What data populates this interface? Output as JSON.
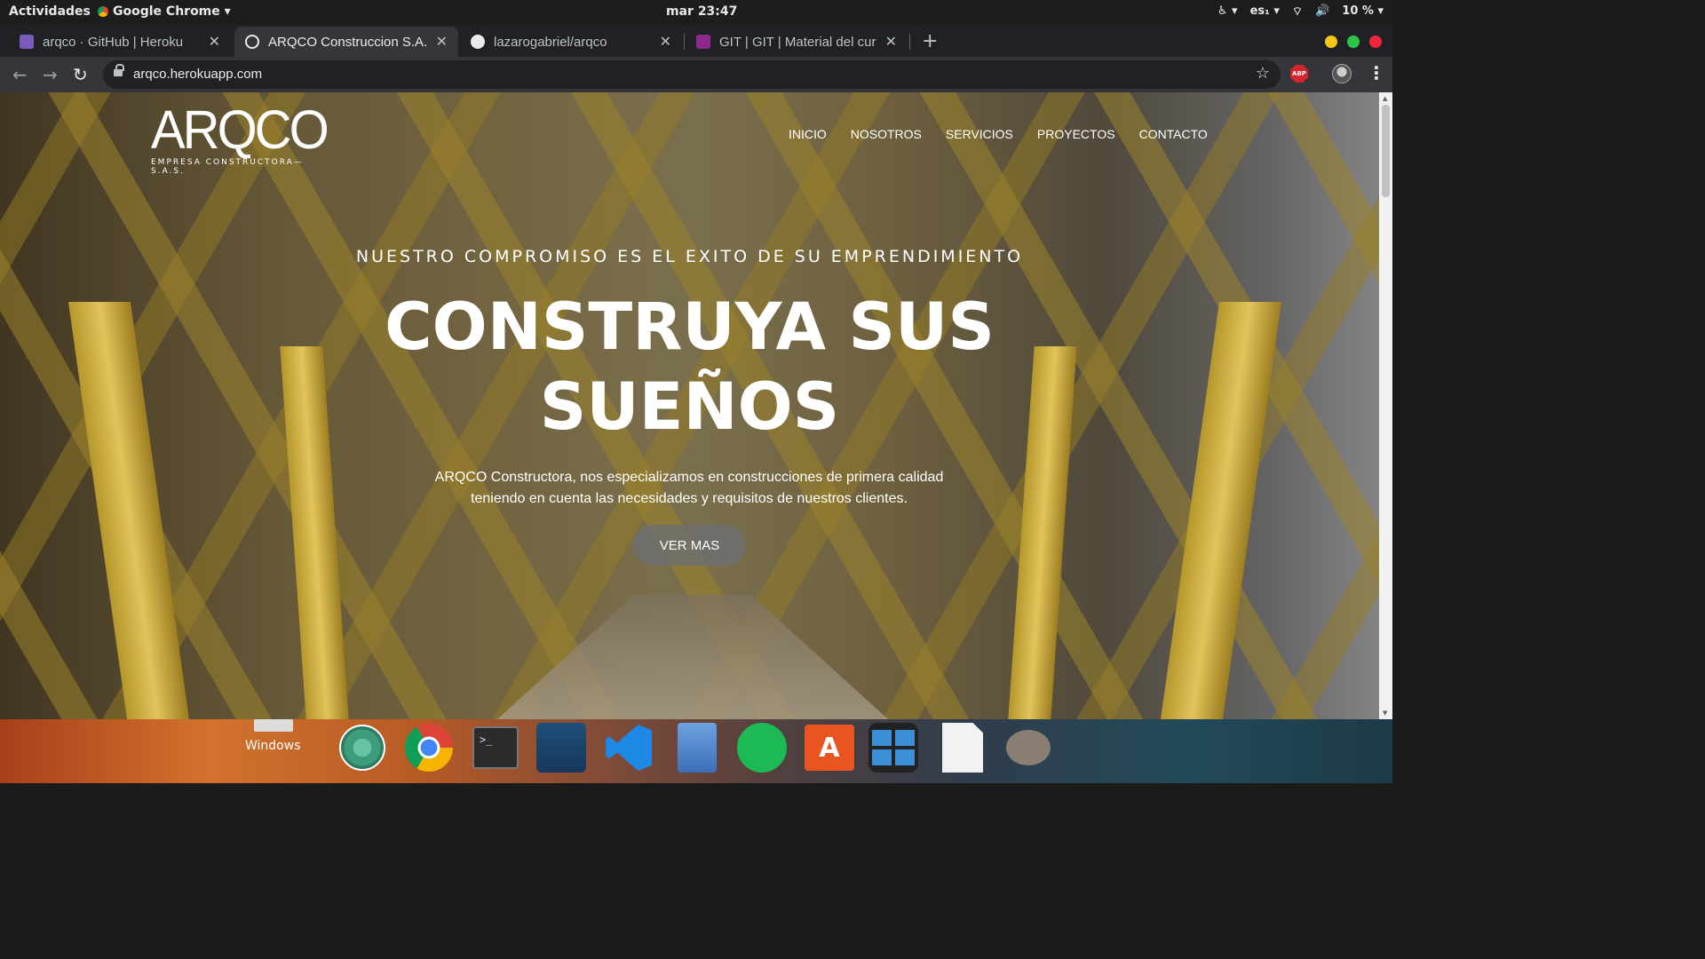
{
  "topbar": {
    "activities": "Actividades",
    "app_name": "Google Chrome ▾",
    "clock": "mar 23:47",
    "lang": "es₁ ▾",
    "battery": "10 % ▾"
  },
  "tabs": [
    {
      "title": "arqco · GitHub | Heroku",
      "favicon_color": "#7b5cb8"
    },
    {
      "title": "ARQCO Construccion S.A.",
      "favicon_color": "#e8eaed"
    },
    {
      "title": "lazarogabriel/arqco",
      "favicon_color": "#e8eaed"
    },
    {
      "title": "GIT | GIT | Material del cur",
      "favicon_color": "#8e2a8f"
    }
  ],
  "browser": {
    "url": "arqco.herokuapp.com",
    "abp": "ABP"
  },
  "site": {
    "logo_text": "ARQCO",
    "logo_tagline": "EMPRESA CONSTRUCTORA—S.A.S.",
    "nav": [
      "INICIO",
      "NOSOTROS",
      "SERVICIOS",
      "PROYECTOS",
      "CONTACTO"
    ],
    "hero_subtitle": "NUESTRO COMPROMISO ES EL EXITO DE SU EMPRENDIMIENTO",
    "hero_title_line1": "CONSTRUYA SUS",
    "hero_title_line2": "SUEÑOS",
    "hero_desc_line1": "ARQCO Constructora, nos especializamos en construcciones de primera calidad",
    "hero_desc_line2": "teniendo en cuenta las necesidades y requisitos de nuestros clientes.",
    "cta": "VER MAS"
  },
  "dock": {
    "windows_label": "Windows",
    "apps": [
      "atom-icon",
      "chrome-icon",
      "terminal-icon",
      "mysql-workbench-icon",
      "vscode-icon",
      "file-cabinet-icon",
      "spotify-icon",
      "app-store-icon",
      "workspaces-icon",
      "text-editor-icon",
      "gimp-icon"
    ]
  }
}
